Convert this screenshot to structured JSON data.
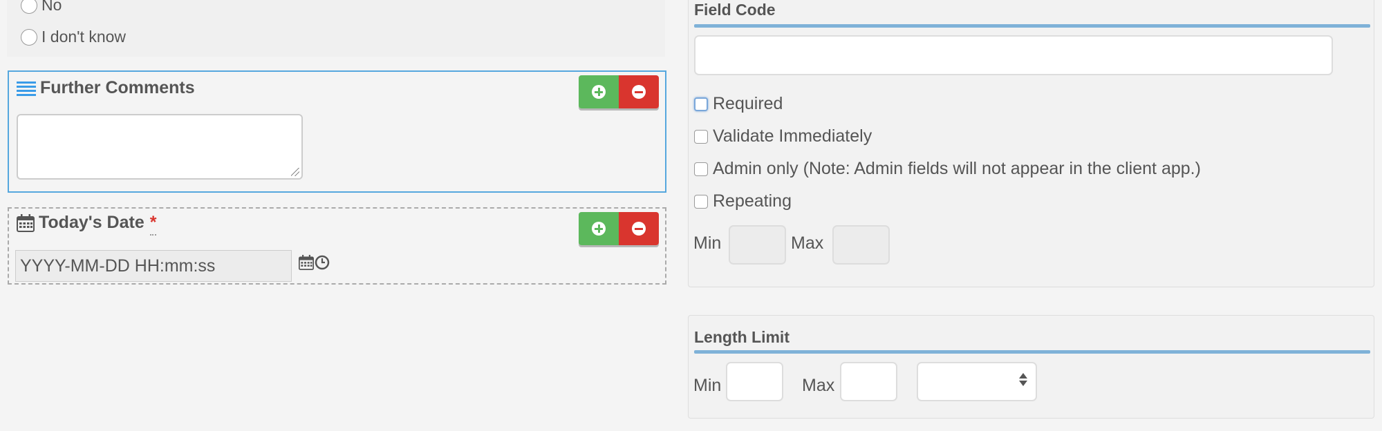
{
  "radio_options": [
    "No",
    "I don't know"
  ],
  "comments_field": {
    "title": "Further Comments",
    "icon": "list-icon",
    "accent_color": "#55a7de"
  },
  "date_field": {
    "title": "Today's Date",
    "required_marker": "*",
    "icon": "calendar-icon",
    "placeholder": "YYYY-MM-DD HH:mm:ss",
    "picker_icons": [
      "calendar-icon",
      "clock-icon"
    ]
  },
  "buttons": {
    "add_icon": "plus-circle-icon",
    "remove_icon": "minus-circle-icon",
    "add_color": "#5cb85c",
    "remove_color": "#d9352e"
  },
  "field_code": {
    "title": "Field Code",
    "value": ""
  },
  "options": {
    "required": "Required",
    "validate_immediately": "Validate Immediately",
    "admin_only": "Admin only (Note: Admin fields will not appear in the client app.)",
    "repeating": "Repeating"
  },
  "repeat_limits": {
    "min_label": "Min",
    "max_label": "Max"
  },
  "length_limit": {
    "title": "Length Limit",
    "min_label": "Min",
    "max_label": "Max",
    "unit_selected": ""
  },
  "section_underline_color": "#7fb2d8"
}
